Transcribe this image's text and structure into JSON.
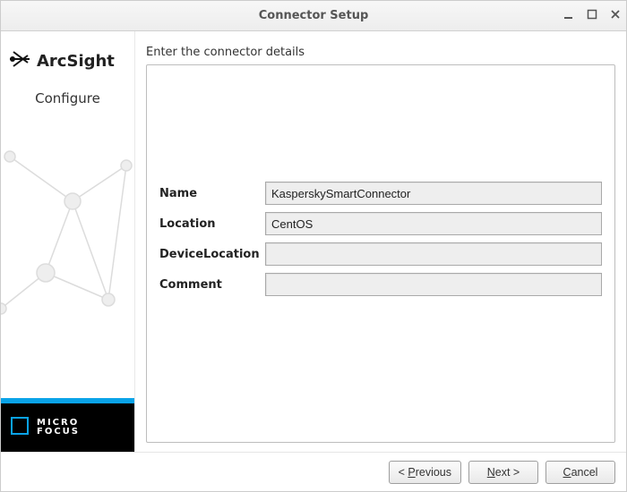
{
  "window": {
    "title": "Connector Setup"
  },
  "sidebar": {
    "brand": "ArcSight",
    "subtitle": "Configure",
    "footer_line1": "MICRO",
    "footer_line2": "FOCUS"
  },
  "main": {
    "instruction": "Enter the connector details",
    "fields": {
      "name_label": "Name",
      "name_value": "KasperskySmartConnector",
      "location_label": "Location",
      "location_value": "CentOS",
      "devicelocation_label": "DeviceLocation",
      "devicelocation_value": "",
      "comment_label": "Comment",
      "comment_value": ""
    }
  },
  "footer": {
    "previous": "< Previous",
    "next": "Next >",
    "cancel": "Cancel"
  }
}
